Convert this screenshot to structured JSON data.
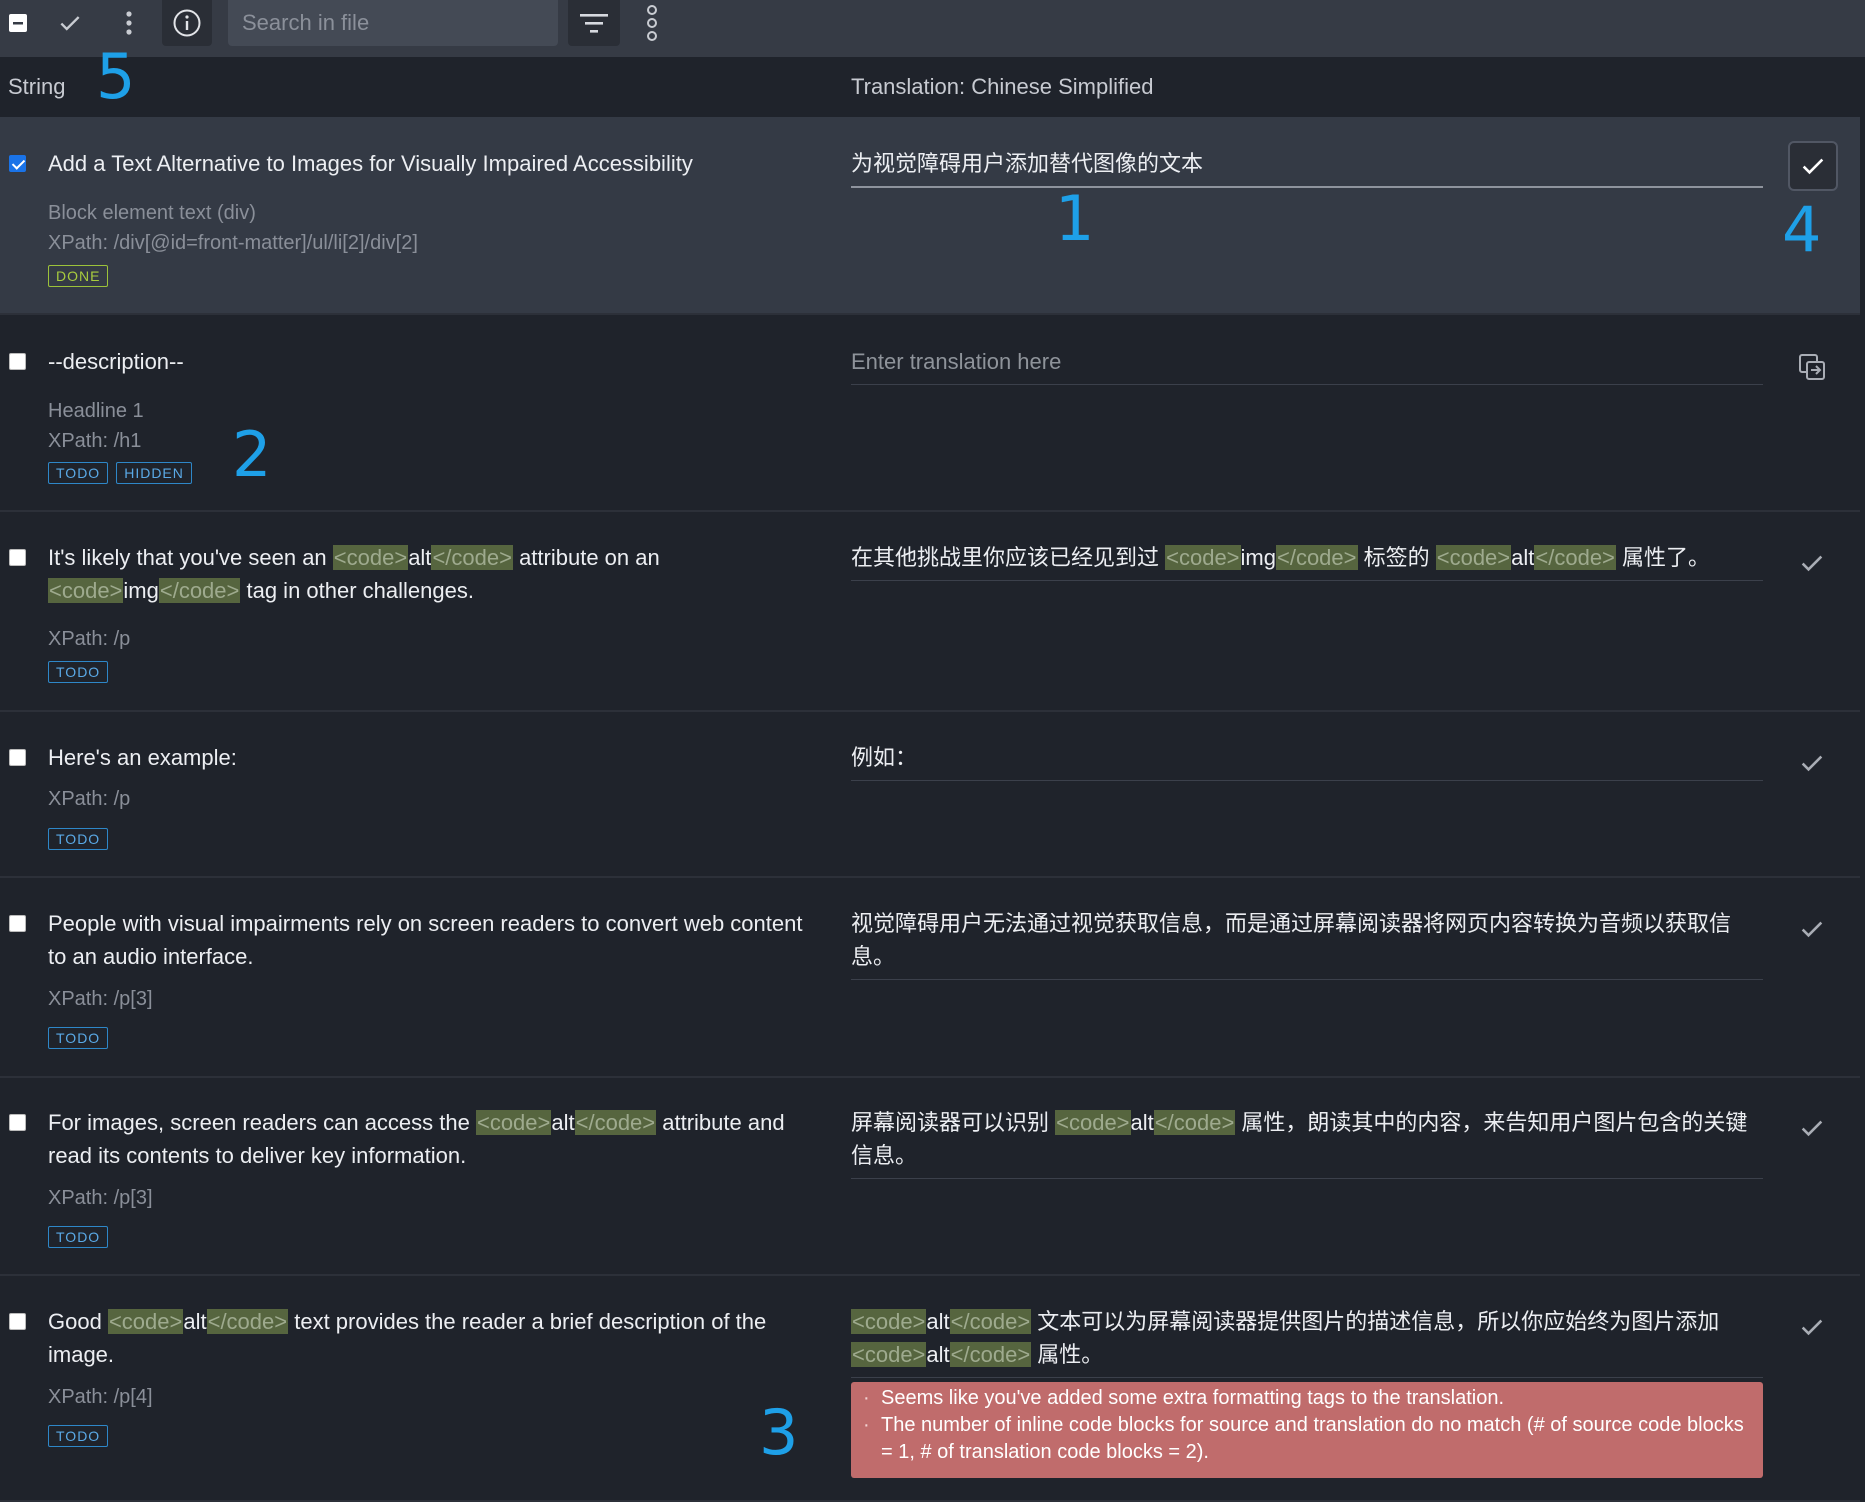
{
  "toolbar": {
    "search_placeholder": "Search in file",
    "icons": [
      "minus-checkbox-icon",
      "check-icon",
      "more-vert-icon",
      "info-icon",
      "filter-icon",
      "more-vert-icon"
    ]
  },
  "header": {
    "source_col": "String",
    "translation_col": "Translation: Chinese Simplified"
  },
  "annotations": [
    "1",
    "2",
    "3",
    "4",
    "5"
  ],
  "rows": [
    {
      "checked": true,
      "source": "Add a Text Alternative to Images for Visually Impaired Accessibility",
      "meta1": "Block element text (div)",
      "meta2": "XPath: /div[@id=front-matter]/ul/li[2]/div[2]",
      "badges": [
        "DONE"
      ],
      "translation": "为视觉障碍用户添加替代图像的文本"
    },
    {
      "checked": false,
      "source": "--description--",
      "meta1": "Headline 1",
      "meta2": "XPath: /h1",
      "badges": [
        "TODO",
        "HIDDEN"
      ],
      "translation_placeholder": "Enter translation here"
    },
    {
      "checked": false,
      "source_parts": [
        "It's likely that you've seen an ",
        "<code>",
        "alt",
        "</code>",
        " attribute on an ",
        "<code>",
        "img",
        "</code>",
        " tag in other challenges."
      ],
      "meta2": "XPath: /p",
      "badges": [
        "TODO"
      ],
      "translation_parts": [
        "在其他挑战里你应该已经见到过 ",
        "<code>",
        "img",
        "</code>",
        " 标签的 ",
        "<code>",
        "alt",
        "</code>",
        " 属性了。"
      ]
    },
    {
      "checked": false,
      "source": "Here's an example:",
      "meta2": "XPath: /p",
      "badges": [
        "TODO"
      ],
      "translation": "例如："
    },
    {
      "checked": false,
      "source": "People with visual impairments rely on screen readers to convert web content to an audio interface.",
      "meta2": "XPath: /p[3]",
      "badges": [
        "TODO"
      ],
      "translation": "视觉障碍用户无法通过视觉获取信息，而是通过屏幕阅读器将网页内容转换为音频以获取信息。"
    },
    {
      "checked": false,
      "source_parts": [
        "For images, screen readers can access the ",
        "<code>",
        "alt",
        "</code>",
        " attribute and read its contents to deliver key information."
      ],
      "meta2": "XPath: /p[3]",
      "badges": [
        "TODO"
      ],
      "translation_parts": [
        "屏幕阅读器可以识别 ",
        "<code>",
        "alt",
        "</code>",
        " 属性，朗读其中的内容，来告知用户图片包含的关键信息。"
      ]
    },
    {
      "checked": false,
      "source_parts": [
        "Good ",
        "<code>",
        "alt",
        "</code>",
        " text provides the reader a brief description of the image."
      ],
      "meta2": "XPath: /p[4]",
      "badges": [
        "TODO"
      ],
      "translation_parts": [
        "<code>",
        "alt",
        "</code>",
        " 文本可以为屏幕阅读器提供图片的描述信息，所以你应始终为图片添加 ",
        "<code>",
        "alt",
        "</code>",
        " 属性。"
      ],
      "errors": [
        "Seems like you've added some extra formatting tags to the translation.",
        "The number of inline code blocks for source and translation do no match (# of source code blocks = 1, # of translation code blocks = 2)."
      ]
    }
  ]
}
